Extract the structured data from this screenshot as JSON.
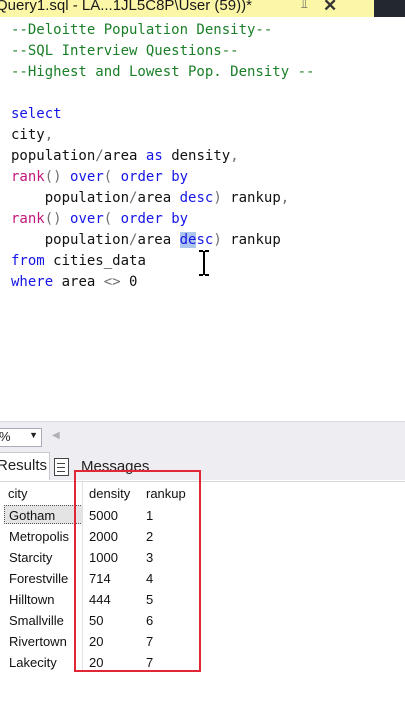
{
  "window": {
    "tab_title": "Query1.sql - LA...1JL5C8P\\User (59))*",
    "pin_icon": "pin-icon",
    "close_icon": "close-icon"
  },
  "editor": {
    "lines": [
      "--Deloitte Population Density--",
      "--SQL Interview Questions--",
      "--Highest and Lowest Pop. Density --",
      "",
      "select",
      "city,",
      "population/area as density,",
      "rank() over( order by",
      "    population/area desc) rankup,",
      "rank() over( order by",
      "    population/area desc) rankup",
      "from cities_data",
      "where area <> 0"
    ],
    "selected_text": "de"
  },
  "status": {
    "zoom": "%"
  },
  "result_tabs": {
    "results": "Results",
    "messages": "Messages"
  },
  "grid": {
    "columns": [
      "city",
      "density",
      "rankup"
    ],
    "rows": [
      [
        "Gotham",
        "5000",
        "1"
      ],
      [
        "Metropolis",
        "2000",
        "2"
      ],
      [
        "Starcity",
        "1000",
        "3"
      ],
      [
        "Forestville",
        "714",
        "4"
      ],
      [
        "Hilltown",
        "444",
        "5"
      ],
      [
        "Smallville",
        "50",
        "6"
      ],
      [
        "Rivertown",
        "20",
        "7"
      ],
      [
        "Lakecity",
        "20",
        "7"
      ]
    ]
  },
  "colors": {
    "highlight_box": "#e32636",
    "comment": "#1a7f28",
    "keyword": "#1515e6",
    "function": "#c2187b"
  }
}
